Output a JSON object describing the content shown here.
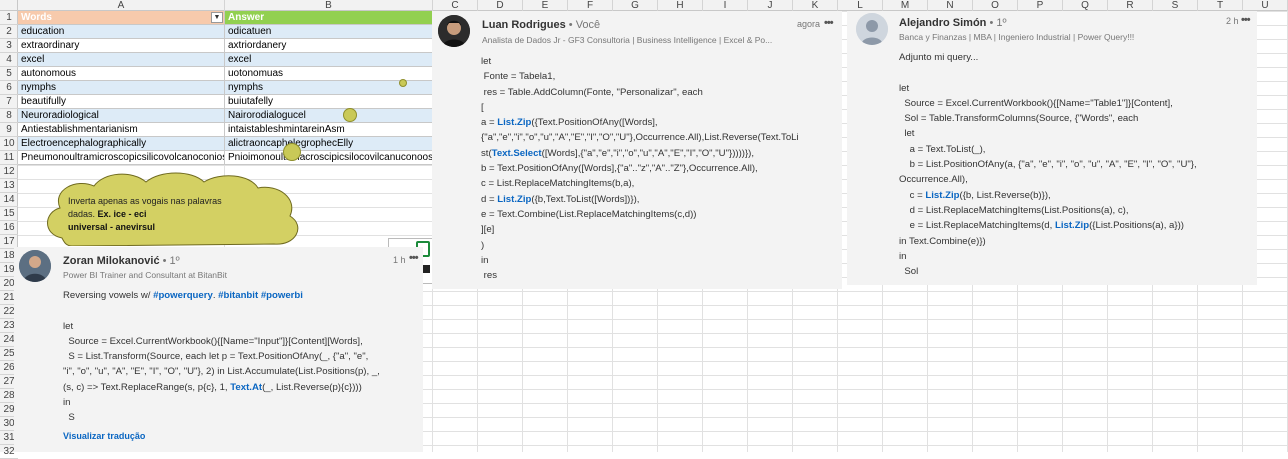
{
  "sheet": {
    "columns": [
      "A",
      "B",
      "C",
      "D",
      "E",
      "F",
      "G",
      "H",
      "I",
      "J",
      "K",
      "L",
      "M",
      "N",
      "O",
      "P",
      "Q",
      "R",
      "S",
      "T",
      "U"
    ],
    "rows": [
      "1",
      "2",
      "3",
      "4",
      "5",
      "6",
      "7",
      "8",
      "9",
      "10",
      "11",
      "12",
      "13",
      "14",
      "15",
      "16",
      "17",
      "18",
      "19",
      "20",
      "21",
      "22",
      "23",
      "24",
      "25",
      "26",
      "27",
      "28",
      "29",
      "30",
      "31",
      "32"
    ],
    "headers": {
      "a": "Words",
      "b": "Answer",
      "filter_icon": "dropdown-arrow-icon"
    },
    "data": [
      {
        "word": "education",
        "answer": "odicatuen"
      },
      {
        "word": "extraordinary",
        "answer": "axtriordanery"
      },
      {
        "word": "excel",
        "answer": "excel"
      },
      {
        "word": "autonomous",
        "answer": "uotonomuas"
      },
      {
        "word": "nymphs",
        "answer": "nymphs"
      },
      {
        "word": "beautifully",
        "answer": "buiutafelly"
      },
      {
        "word": "Neuroradiological",
        "answer": "Nairorodialogucel"
      },
      {
        "word": "Antiestablishmentarianism",
        "answer": "intaistableshmintareinAsm"
      },
      {
        "word": "Electroencephalographically",
        "answer": "alictraoncaphelegrophecElly"
      },
      {
        "word": "Pneumonoultramicroscopicsilicovolcanoconiosis",
        "answer": "Pnioimonoultrimacroscipicsilocovilcanuconoosis"
      }
    ],
    "cloud_text": {
      "line1": "Inverta apenas as vogais nas palavras",
      "line2_prefix": "dadas. ",
      "line2_bold": "Ex. ice - eci",
      "line3": "universal - anevirsul"
    }
  },
  "comments": [
    {
      "name": "Luan Rodrigues",
      "badge": "• Você",
      "subtitle": "Analista de Dados Jr - GF3 Consultoria | Business Intelligence | Excel & Po...",
      "time": "agora",
      "more": "•••",
      "lines": [
        [
          "let"
        ],
        [
          " Fonte = Tabela1,"
        ],
        [
          " res = Table.AddColumn(Fonte, \"Personalizar\", each"
        ],
        [
          "["
        ],
        [
          "a = ",
          {
            "link": "List.Zip"
          },
          "({Text.PositionOfAny([Words],"
        ],
        [
          "{\"a\",\"e\",\"i\",\"o\",\"u\",\"A\",\"E\",\"I\",\"O\",\"U\"},Occurrence.All),List.Reverse(Text.ToLi"
        ],
        [
          "st(",
          {
            "link": "Text.Select"
          },
          "([Words],{\"a\",\"e\",\"i\",\"o\",\"u\",\"A\",\"E\",\"I\",\"O\",\"U\"}))))}),"
        ],
        [
          "b = Text.PositionOfAny([Words],{\"a\"..\"z\",\"A\"..\"Z\"},Occurrence.All),"
        ],
        [
          "c = List.ReplaceMatchingItems(b,a),"
        ],
        [
          "d = ",
          {
            "link": "List.Zip"
          },
          "({b,Text.ToList([Words])}),"
        ],
        [
          "e = Text.Combine(List.ReplaceMatchingItems(c,d))"
        ],
        [
          "][e]"
        ],
        [
          ")"
        ],
        [
          "in"
        ],
        [
          " res"
        ]
      ]
    },
    {
      "name": "Alejandro Simón",
      "badge": "• 1º",
      "subtitle": "Banca y Finanzas | MBA | Ingeniero Industrial | Power Query!!!",
      "time": "2 h",
      "more": "•••",
      "lines": [
        [
          "Adjunto mi query..."
        ],
        [
          ""
        ],
        [
          "let"
        ],
        [
          "  Source = Excel.CurrentWorkbook(){[Name=\"Table1\"]}[Content],"
        ],
        [
          "  Sol = Table.TransformColumns(Source, {\"Words\", each"
        ],
        [
          "  let"
        ],
        [
          "    a = Text.ToList(_),"
        ],
        [
          "    b = List.PositionOfAny(a, {\"a\", \"e\", \"i\", \"o\", \"u\", \"A\", \"E\", \"I\", \"O\", \"U\"},"
        ],
        [
          "Occurrence.All),"
        ],
        [
          "    c = ",
          {
            "link": "List.Zip"
          },
          "({b, List.Reverse(b)}),"
        ],
        [
          "    d = List.ReplaceMatchingItems(List.Positions(a), c),"
        ],
        [
          "    e = List.ReplaceMatchingItems(d, ",
          {
            "link": "List.Zip"
          },
          "({List.Positions(a), a}))"
        ],
        [
          "in Text.Combine(e)})"
        ],
        [
          "in"
        ],
        [
          "  Sol"
        ]
      ]
    },
    {
      "name": "Zoran Milokanović",
      "badge": "• 1º",
      "subtitle": "Power BI Trainer and Consultant at BitanBit",
      "time": "1 h",
      "more": "•••",
      "lines": [
        [
          "Reversing vowels w/ ",
          {
            "link": "#powerquery"
          },
          ". ",
          {
            "link": "#bitanbit"
          },
          " ",
          {
            "link": "#powerbi"
          }
        ],
        [
          ""
        ],
        [
          "let"
        ],
        [
          "  Source = Excel.CurrentWorkbook(){[Name=\"Input\"]}[Content][Words],"
        ],
        [
          "  S = List.Transform(Source, each let p = Text.PositionOfAny(_, {\"a\", \"e\","
        ],
        [
          "\"i\", \"o\", \"u\", \"A\", \"E\", \"I\", \"O\", \"U\"}, 2) in List.Accumulate(List.Positions(p), _,"
        ],
        [
          "(s, c) => Text.ReplaceRange(s, p{c}, 1, ",
          {
            "link": "Text.At"
          },
          "(_, List.Reverse(p){c})))"
        ],
        [
          "in"
        ],
        [
          "  S"
        ]
      ],
      "translate": "Visualizar tradução"
    }
  ]
}
